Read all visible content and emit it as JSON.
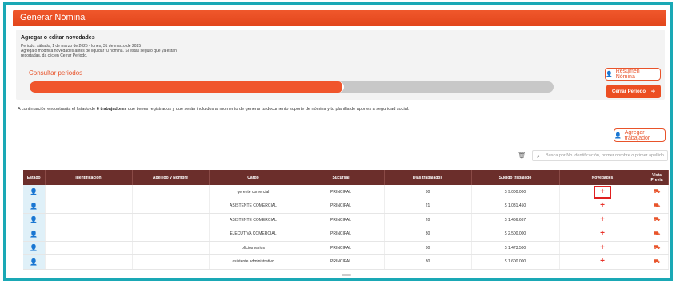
{
  "header": {
    "title": "Generar Nómina"
  },
  "panel": {
    "title": "Agregar o editar novedades",
    "lines": [
      "Periodo: sábado, 1 de marzo de 2025 - lunes, 31 de marzo de 2025",
      "Agrega o modifica novedades antes de liquidar tu nómina. Si estás seguro que ya están",
      "reportadas, da clic en Cerrar Periodo."
    ],
    "consult_label": "Consultar periodos",
    "progress_percent": 60
  },
  "buttons": {
    "resumen": "Resumen Nómina",
    "cerrar": "Cerrar Periodo",
    "agregar": "Agregar trabajador"
  },
  "intro": {
    "before": "A continuación encontrarás el listado de ",
    "count": "6 trabajadores",
    "after": " que tienes registrados y que serán incluidos al momento de generar tu documento soporte de nómina y tu planilla de aportes a seguridad social."
  },
  "search": {
    "placeholder": "Busca por No Identificación, primer nombre o primer apellido"
  },
  "table": {
    "headers": [
      "Estado",
      "Identificación",
      "Apellido y Nombre",
      "Cargo",
      "Sucursal",
      "Días trabajados",
      "Sueldo trabajado",
      "Novedades",
      "Vista Previa"
    ],
    "rows": [
      {
        "cargo": "gerente comercial",
        "sucursal": "PRINCIPAL",
        "dias": "30",
        "sueldo": "$ 9.000.000"
      },
      {
        "cargo": "ASISTENTE COMERCIAL",
        "sucursal": "PRINCIPAL",
        "dias": "21",
        "sueldo": "$ 1.031.450"
      },
      {
        "cargo": "ASISTENTE COMERCIAL",
        "sucursal": "PRINCIPAL",
        "dias": "20",
        "sueldo": "$ 1.466.667"
      },
      {
        "cargo": "EJECUTIVA COMERCIAL",
        "sucursal": "PRINCIPAL",
        "dias": "30",
        "sueldo": "$ 2.500.000"
      },
      {
        "cargo": "oficios varios",
        "sucursal": "PRINCIPAL",
        "dias": "30",
        "sueldo": "$ 1.473.500"
      },
      {
        "cargo": "asistente administrativo",
        "sucursal": "PRINCIPAL",
        "dias": "30",
        "sueldo": "$ 1.600.000"
      }
    ]
  },
  "icons": {
    "user": "user-gear-icon",
    "plus": "plus-icon",
    "preview": "preview-icon",
    "search": "search-icon",
    "trash": "trash-icon"
  },
  "colors": {
    "accent": "#e8532a",
    "header_dark": "#6b2e2b",
    "border_teal": "#1aa8b5"
  }
}
